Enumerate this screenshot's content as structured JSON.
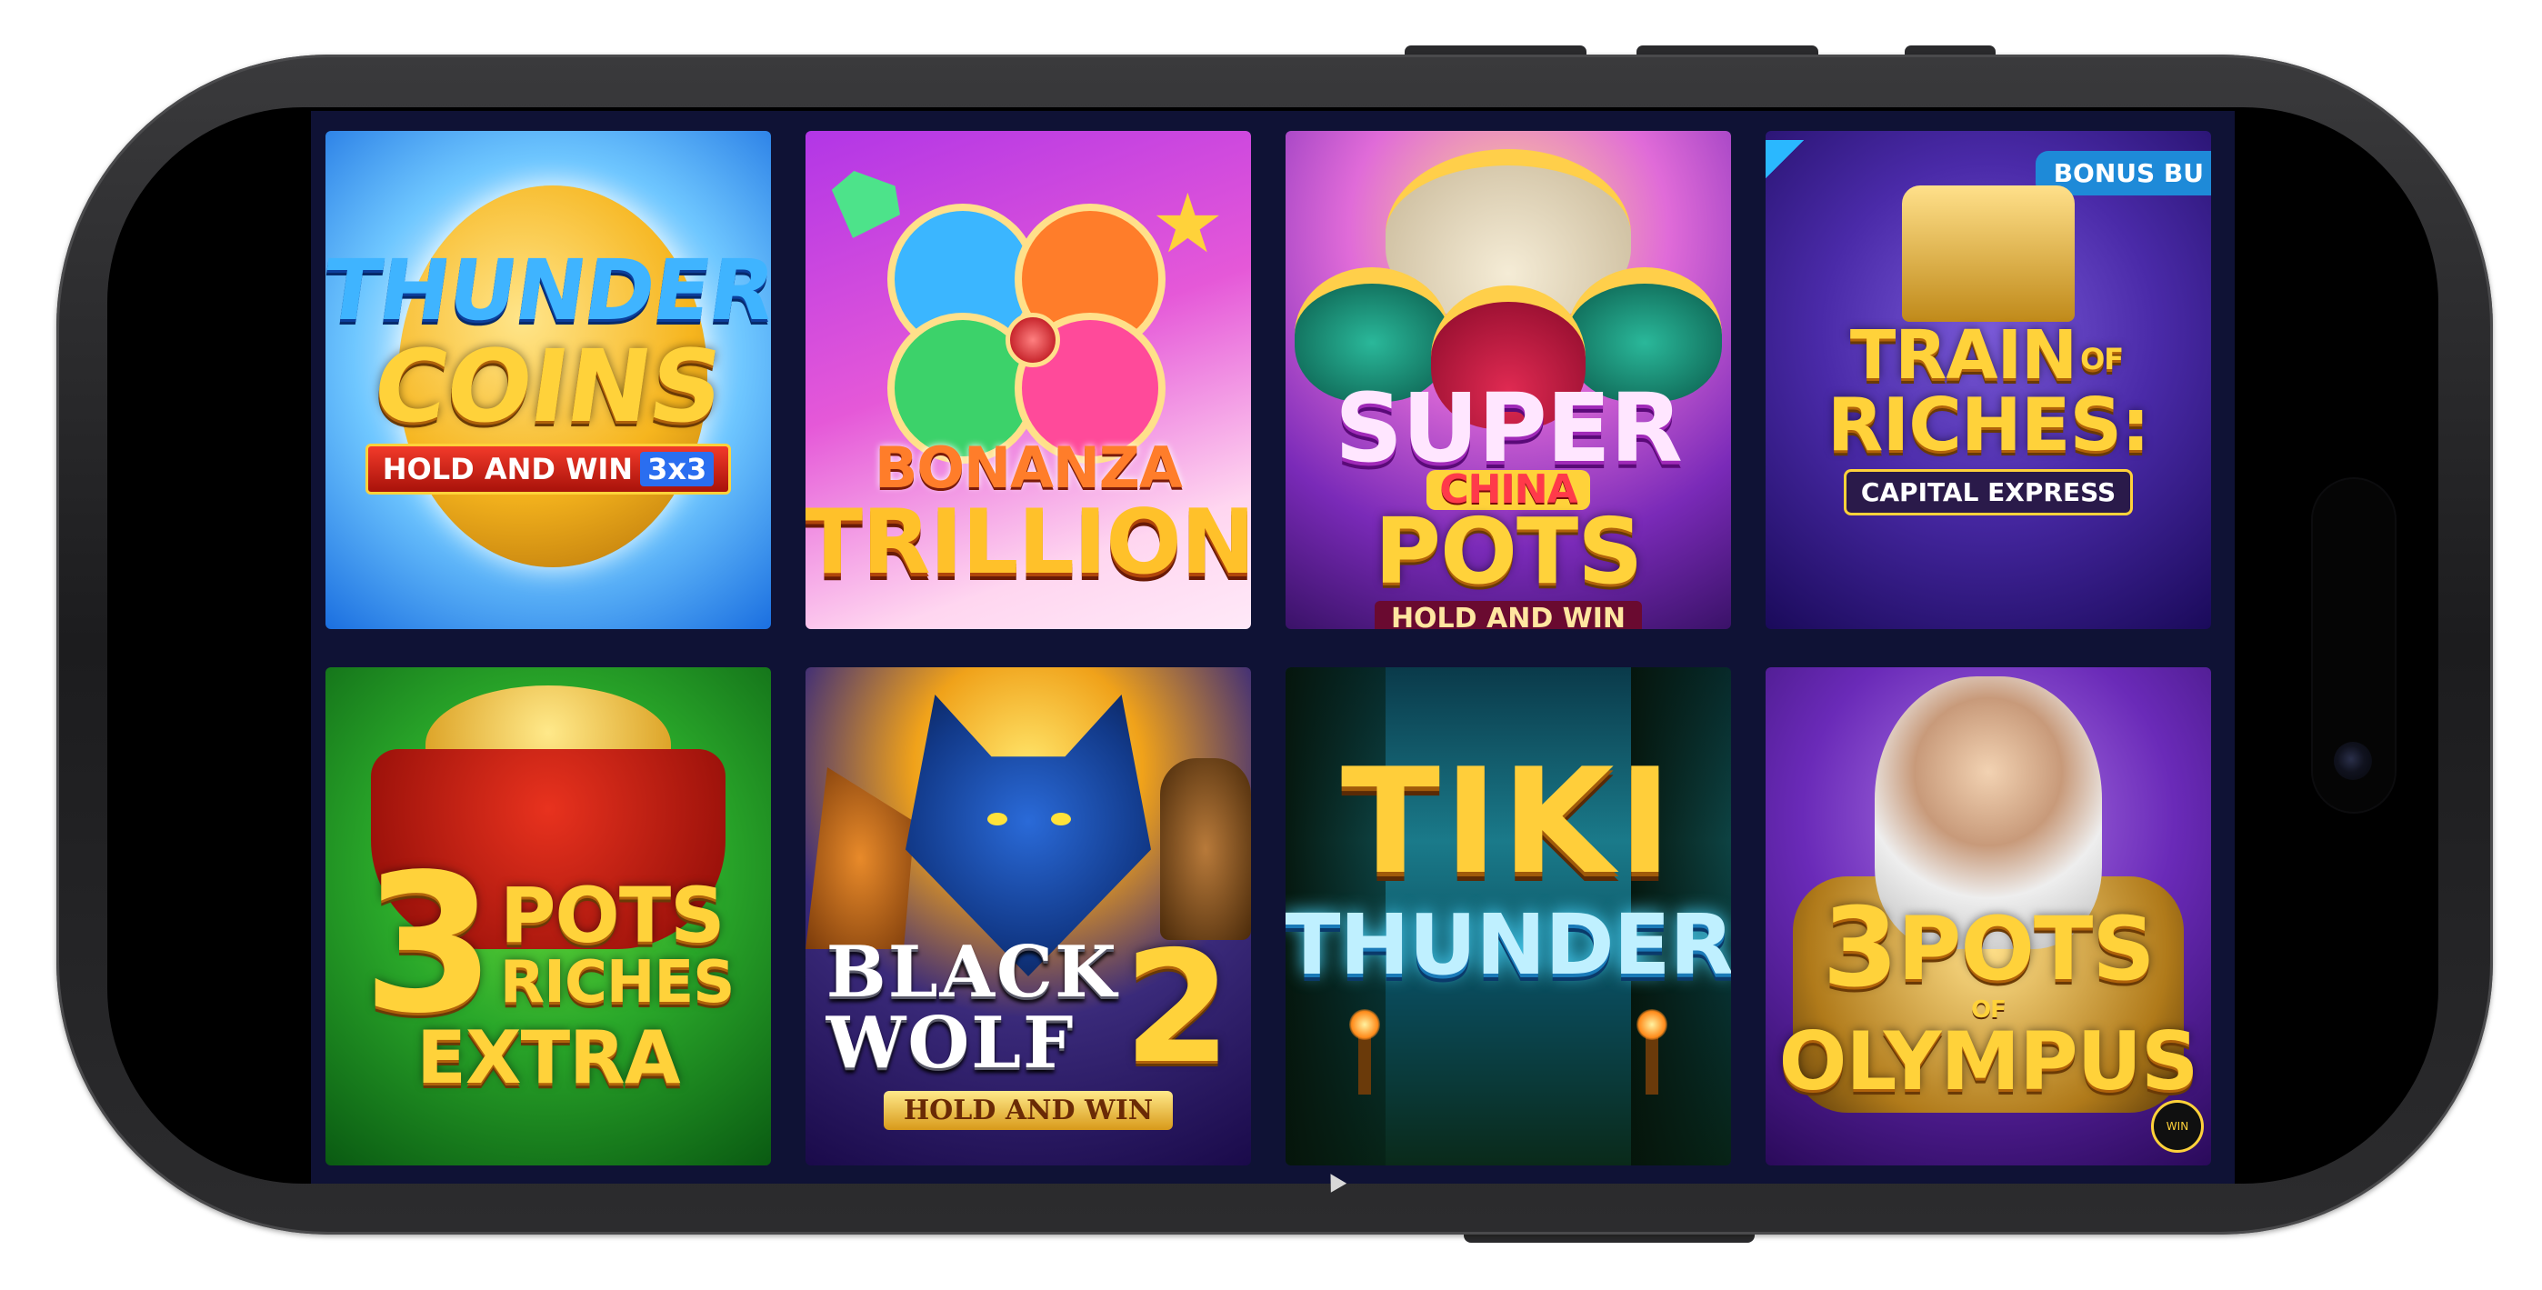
{
  "games": [
    {
      "id": "thunder-coins",
      "title_line1": "THUNDER",
      "title_line2": "COINS",
      "badge": "HOLD AND WIN",
      "badge_extra": "3x3"
    },
    {
      "id": "bonanza-trillion",
      "title_line1": "BONANZA",
      "title_line2": "TRILLION"
    },
    {
      "id": "super-china-pots",
      "title_line1": "SUPER",
      "title_line2": "CHINA",
      "title_line3": "POTS",
      "badge": "HOLD AND WIN"
    },
    {
      "id": "train-of-riches",
      "title_line1a": "TRAIN",
      "title_line1b": "OF",
      "title_line2": "RICHES:",
      "badge": "CAPITAL EXPRESS",
      "corner_label": "BONUS BU"
    },
    {
      "id": "3-pots-riches-extra",
      "number": "3",
      "title_line1": "POTS",
      "title_line2": "RICHES",
      "title_line3": "EXTRA"
    },
    {
      "id": "black-wolf-2",
      "title_line1": "BLACK",
      "title_line2": "WOLF",
      "number": "2",
      "badge": "HOLD AND WIN"
    },
    {
      "id": "tiki-thunder",
      "title_line1": "TIKI",
      "title_line2": "THUNDER"
    },
    {
      "id": "3-pots-of-olympus",
      "number": "3",
      "title_line1": "POTS",
      "title_line2": "OF",
      "title_line3": "OLYMPUS",
      "watermark": "WIN"
    }
  ],
  "colors": {
    "grid_background": "#0f1235",
    "phone_frame": "#1c1c1e",
    "gold_text": "#ffd23a",
    "bonus_badge": "#1e8ad8"
  }
}
